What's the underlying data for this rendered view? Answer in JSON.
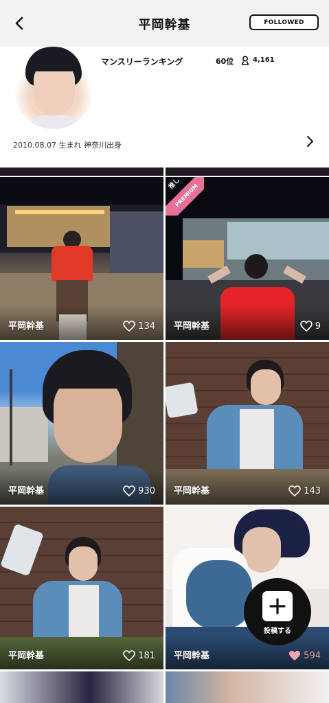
{
  "header": {
    "title": "平岡幹基",
    "follow_label": "FOLLOWED",
    "back_icon": "chevron-left-icon"
  },
  "profile": {
    "ranking_label": "マンスリーランキング",
    "ranking_position": "60位",
    "ranking_count": "4,161",
    "birth_info": "2010.08.07 生まれ  神奈川出身",
    "more_icon": "chevron-right-icon"
  },
  "posts": [
    {
      "name": "平岡幹基",
      "likes": "134",
      "liked": false,
      "premium": false
    },
    {
      "name": "平岡幹基",
      "likes": "9",
      "liked": false,
      "premium": true
    },
    {
      "name": "平岡幹基",
      "likes": "930",
      "liked": false,
      "premium": false
    },
    {
      "name": "平岡幹基",
      "likes": "143",
      "liked": false,
      "premium": false
    },
    {
      "name": "平岡幹基",
      "likes": "181",
      "liked": false,
      "premium": false
    },
    {
      "name": "平岡幹基",
      "likes": "594",
      "liked": true,
      "premium": false
    }
  ],
  "premium_badge": {
    "tag": "推し",
    "label": "PREMIUM"
  },
  "fab": {
    "label": "投稿する",
    "icon": "plus-icon"
  },
  "colors": {
    "header_bg": "#f3f1f4",
    "liked_heart": "#f3a5ae",
    "premium": "#e86f95"
  }
}
